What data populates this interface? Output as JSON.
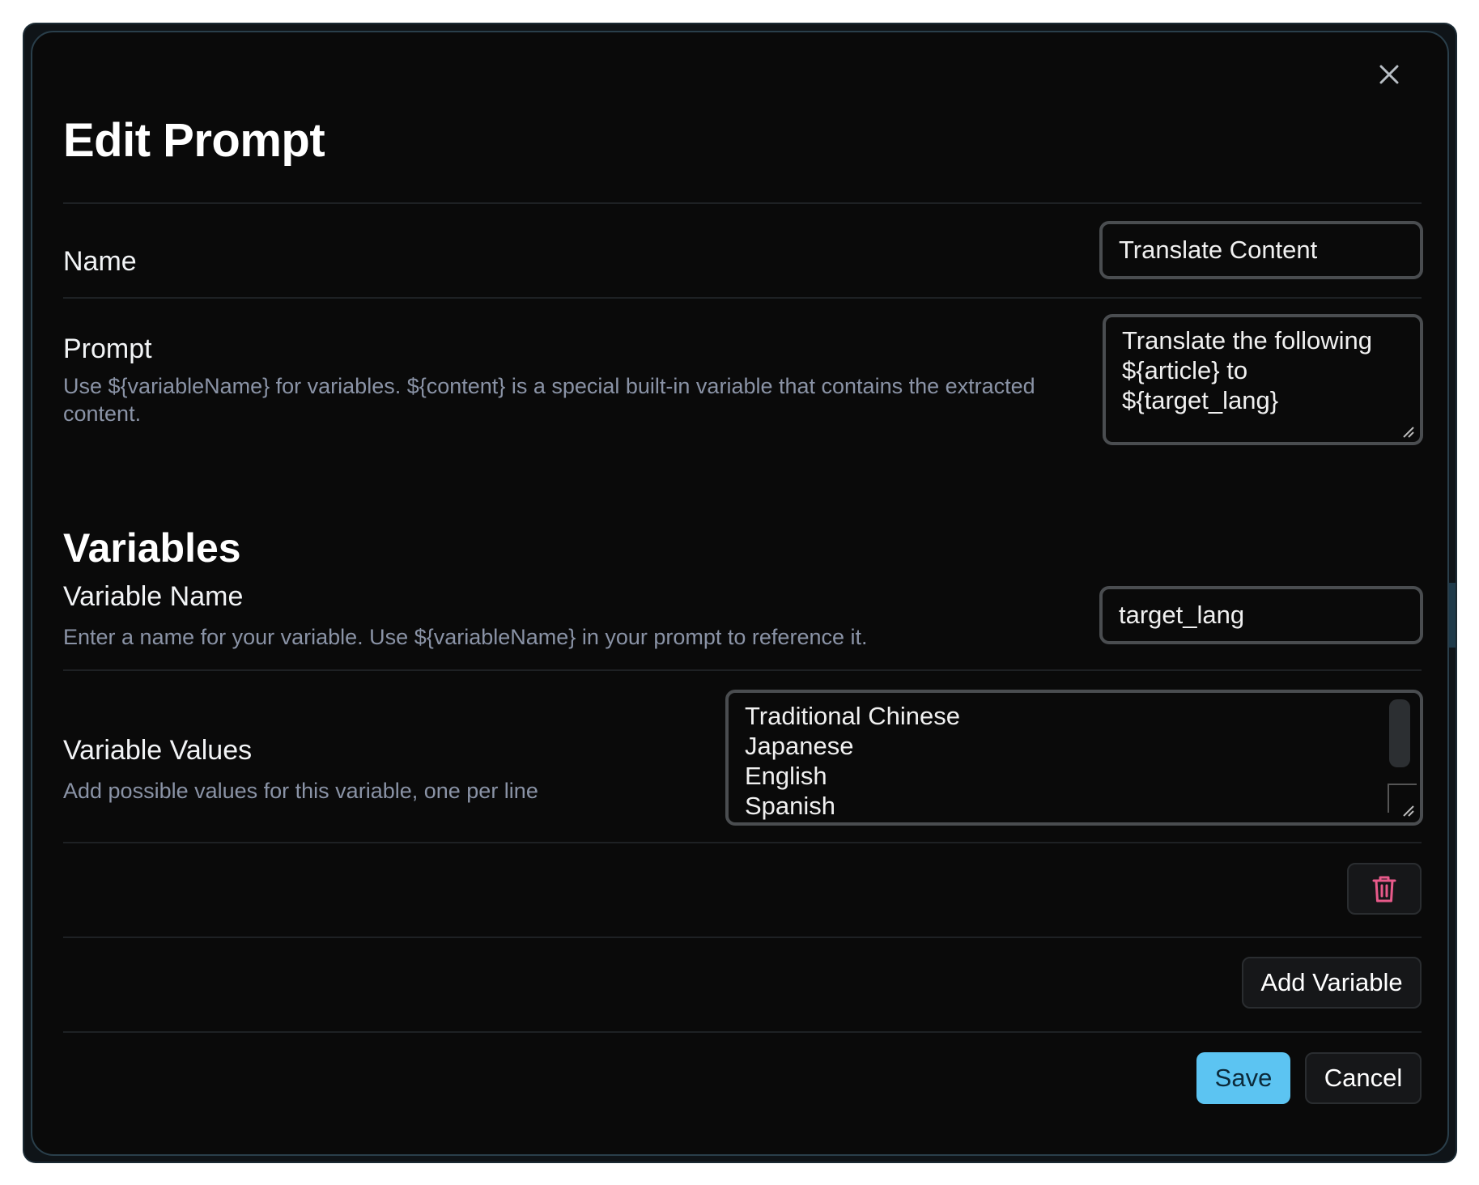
{
  "modal": {
    "title": "Edit Prompt",
    "close_icon": "close-icon"
  },
  "name_row": {
    "label": "Name",
    "value": "Translate Content"
  },
  "prompt_row": {
    "label": "Prompt",
    "description": "Use ${variableName} for variables. ${content} is a special built-in variable that contains the extracted content.",
    "value": "Translate the following\n${article} to ${target_lang}"
  },
  "variables": {
    "title": "Variables",
    "name_label": "Variable Name",
    "name_description": "Enter a name for your variable. Use ${variableName} in your prompt to reference it.",
    "name_value": "target_lang",
    "values_label": "Variable Values",
    "values_description": "Add possible values for this variable, one per line",
    "values_value": "Traditional Chinese\nJapanese\nEnglish\nSpanish",
    "delete_icon": "trash-icon",
    "delete_icon_color": "#e85a8a",
    "add_label": "Add Variable"
  },
  "footer": {
    "save_label": "Save",
    "cancel_label": "Cancel",
    "save_color": "#5cc4f2"
  }
}
